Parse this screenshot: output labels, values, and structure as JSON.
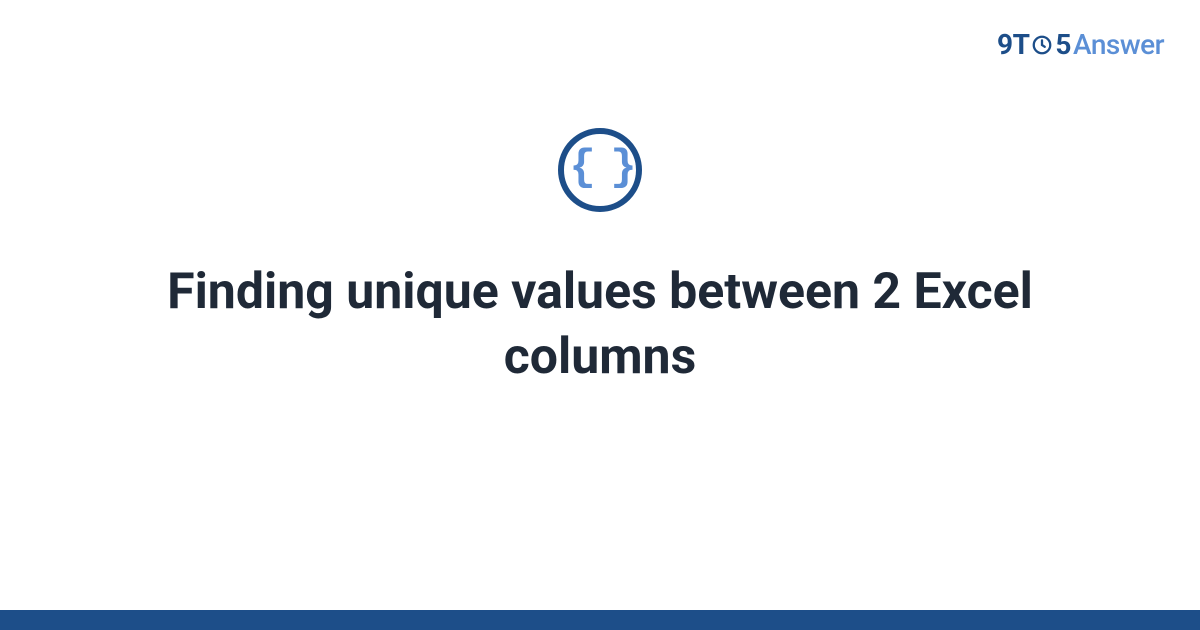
{
  "logo": {
    "part1": "9T",
    "part2": "5",
    "part3": "Answer"
  },
  "badge": {
    "symbol": "{ }"
  },
  "title": "Finding unique values between 2 Excel columns",
  "colors": {
    "brandDark": "#1d4e89",
    "brandLight": "#5b8fd6",
    "textDark": "#1f2937"
  }
}
